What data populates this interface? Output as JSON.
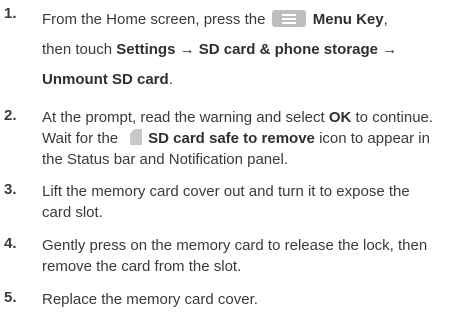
{
  "steps": [
    {
      "num": "1.",
      "l1_pre": "From the Home screen, press the",
      "l1_bold": "Menu Key",
      "l1_post": ",",
      "l2_pre": "then touch",
      "l2_bold": "Settings → SD card & phone storage →",
      "l3_bold": "Unmount SD card",
      "l3_post": "."
    },
    {
      "num": "2.",
      "l1_pre": "At the prompt, read the warning and select",
      "l1_bold": "OK",
      "l1_post": "to continue.",
      "l2_pre": "Wait for the",
      "l2_bold": "SD card safe to remove",
      "l2_post": "icon to appear in",
      "l3": "the Status bar and Notification panel."
    },
    {
      "num": "3.",
      "l1": "Lift the memory card cover out and turn it to expose the",
      "l2": "card slot."
    },
    {
      "num": "4.",
      "l1": "Gently press on the memory card to release the lock, then",
      "l2": "remove the card from the slot."
    },
    {
      "num": "5.",
      "l1": "Replace the memory card cover."
    }
  ]
}
